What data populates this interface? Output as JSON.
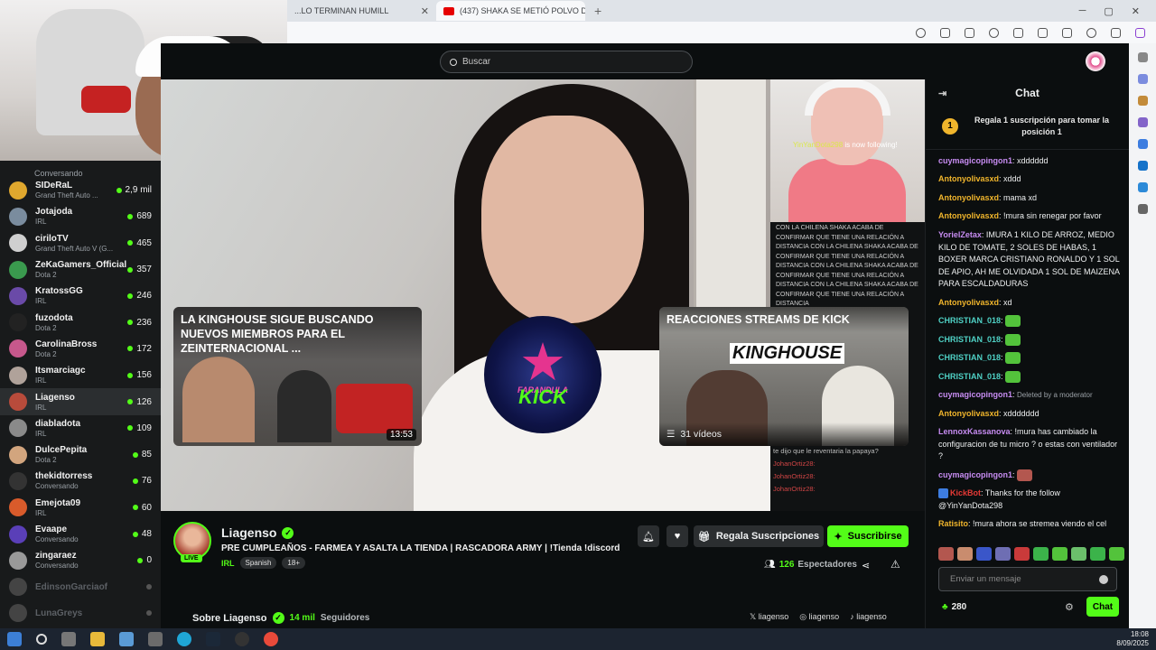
{
  "browser": {
    "tabs": [
      {
        "title": "...LO TERMINAN HUMILL"
      },
      {
        "title": "(437) SHAKA SE METIÓ POLVO D",
        "active": true
      }
    ]
  },
  "topbar": {
    "search_placeholder": "Buscar"
  },
  "sidebar": {
    "top_status": "Conversando",
    "items": [
      {
        "name": "SIDeRaL",
        "category": "Grand Theft Auto ...",
        "viewers": "2,9 mil",
        "color": "#e0a82e"
      },
      {
        "name": "Jotajoda",
        "category": "IRL",
        "viewers": "689",
        "color": "#7a8c9e"
      },
      {
        "name": "ciriloTV",
        "category": "Grand Theft Auto V (G...",
        "viewers": "465",
        "color": "#cfcfcf"
      },
      {
        "name": "ZeKaGamers_Official",
        "category": "Dota 2",
        "viewers": "357",
        "color": "#3a9a4e"
      },
      {
        "name": "KratossGG",
        "category": "IRL",
        "viewers": "246",
        "color": "#6a4aa8"
      },
      {
        "name": "fuzodota",
        "category": "Dota 2",
        "viewers": "236",
        "color": "#222222"
      },
      {
        "name": "CarolinaBross",
        "category": "Dota 2",
        "viewers": "172",
        "color": "#c7588c"
      },
      {
        "name": "Itsmarciagc",
        "category": "IRL",
        "viewers": "156",
        "color": "#b0a29a"
      },
      {
        "name": "Liagenso",
        "category": "IRL",
        "viewers": "126",
        "color": "#b84b3b",
        "selected": true
      },
      {
        "name": "diabladota",
        "category": "IRL",
        "viewers": "109",
        "color": "#8a8a8a"
      },
      {
        "name": "DulcePepita",
        "category": "Dota 2",
        "viewers": "85",
        "color": "#d2a57e"
      },
      {
        "name": "thekidtorress",
        "category": "Conversando",
        "viewers": "76",
        "color": "#333333"
      },
      {
        "name": "Emejota09",
        "category": "IRL",
        "viewers": "60",
        "color": "#d95b2b"
      },
      {
        "name": "Evaape",
        "category": "Conversando",
        "viewers": "48",
        "color": "#5a3fb8"
      },
      {
        "name": "zingaraez",
        "category": "Conversando",
        "viewers": "0",
        "color": "#999999"
      },
      {
        "name": "EdinsonGarciaof",
        "category": "",
        "viewers": "",
        "color": "#444444",
        "offline": true
      },
      {
        "name": "LunaGreys",
        "category": "",
        "viewers": "",
        "color": "#444444",
        "offline": true
      }
    ]
  },
  "stream": {
    "pip_name": "YinYanDota298",
    "pip_follow": "is now following!",
    "news_text": "CON LA CHILENA SHAKA ACABA DE CONFIRMAR QUE TIENE UNA RELACIÓN A DISTANCIA CON LA CHILENA SHAKA ACABA DE CONFIRMAR QUE TIENE UNA RELACIÓN A DISTANCIA CON LA CHILENA SHAKA ACABA DE CONFIRMAR QUE TIENE UNA RELACIÓN A DISTANCIA CON LA CHILENA SHAKA ACABA DE CONFIRMAR QUE TIENE UNA RELACIÓN A DISTANCIA",
    "embed_chat": [
      "te dijo que le reventaria la papaya?",
      "JohanOrtiz28:",
      "JohanOrtiz28:",
      "JohanOrtiz28:"
    ],
    "video1": {
      "title": "LA KINGHOUSE SIGUE BUSCANDO NUEVOS MIEMBROS PARA EL ZEINTERNACIONAL ...",
      "duration": "13:53"
    },
    "video2": {
      "title": "REACCIONES STREAMS DE KICK",
      "banner": "KINGHOUSE",
      "count": "31 vídeos"
    },
    "logo": {
      "top": "FARANDULA",
      "bottom": "KICK"
    }
  },
  "channel": {
    "name": "Liagenso",
    "live_badge": "LIVE",
    "title": "PRE CUMPLEAÑOS - FARMEA Y ASALTA LA TIENDA | RASCADORA ARMY | !Tienda !discord",
    "category": "IRL",
    "tags": [
      "Spanish",
      "18+"
    ],
    "gift_label": "Regala Suscripciones",
    "subscribe_label": "Suscribirse",
    "viewers_count": "126",
    "viewers_label": "Espectadores",
    "about_label": "Sobre Liagenso",
    "followers_count": "14 mil",
    "followers_label": "Seguidores",
    "socials": [
      "liagenso",
      "liagenso",
      "liagenso"
    ]
  },
  "chat": {
    "header": "Chat",
    "leader_rank": "1",
    "leader_text": "Regala 1 suscripción para tomar la posición 1",
    "messages": [
      {
        "user": "cuymagicopingon1",
        "color": "#c78cf2",
        "text": "xdddddd"
      },
      {
        "user": "Antonyolivasxd",
        "color": "#f0b52c",
        "text": "xddd"
      },
      {
        "user": "Antonyolivasxd",
        "color": "#f0b52c",
        "text": "mama xd"
      },
      {
        "user": "Antonyolivasxd",
        "color": "#f0b52c",
        "text": "!mura sin renegar por favor"
      },
      {
        "user": "YorielZetax",
        "color": "#c78cf2",
        "text": "IMURA 1 KILO DE ARROZ, MEDIO KILO DE TOMATE, 2 SOLES DE HABAS, 1 BOXER MARCA CRISTIANO RONALDO Y 1 SOL DE APIO, AH ME OLVIDADA 1 SOL DE MAIZENA PARA ESCALDADURAS"
      },
      {
        "user": "Antonyolivasxd",
        "color": "#f0b52c",
        "text": "xd"
      },
      {
        "user": "CHRISTIAN_018",
        "color": "#4fd1c5",
        "text": "",
        "emote": true
      },
      {
        "user": "CHRISTIAN_018",
        "color": "#4fd1c5",
        "text": "",
        "emote": true
      },
      {
        "user": "CHRISTIAN_018",
        "color": "#4fd1c5",
        "text": "",
        "emote": true
      },
      {
        "user": "CHRISTIAN_018",
        "color": "#4fd1c5",
        "text": "",
        "emote": true
      },
      {
        "user": "cuymagicopingon1",
        "color": "#c78cf2",
        "text": "Deleted by a moderator",
        "deleted": true
      },
      {
        "user": "Antonyolivasxd",
        "color": "#f0b52c",
        "text": "xddddddd"
      },
      {
        "user": "LennoxKassanova",
        "color": "#c78cf2",
        "text": "!mura has cambiado la configuracion de tu micro ? o estas con ventilador ?"
      },
      {
        "user": "cuymagicopingon1",
        "color": "#c78cf2",
        "text": "",
        "emote": true,
        "emote_color": "red"
      },
      {
        "user": "KickBot",
        "color": "#e53935",
        "text": "Thanks for the follow @YinYanDota298",
        "bot": true
      },
      {
        "user": "Ratisito",
        "color": "#f0b52c",
        "text": "!mura ahora se stremea viendo el cel"
      }
    ],
    "input_placeholder": "Enviar un mensaje",
    "points": "280",
    "send_label": "Chat"
  },
  "taskbar": {
    "time": "18:08",
    "date": "8/09/2025"
  }
}
